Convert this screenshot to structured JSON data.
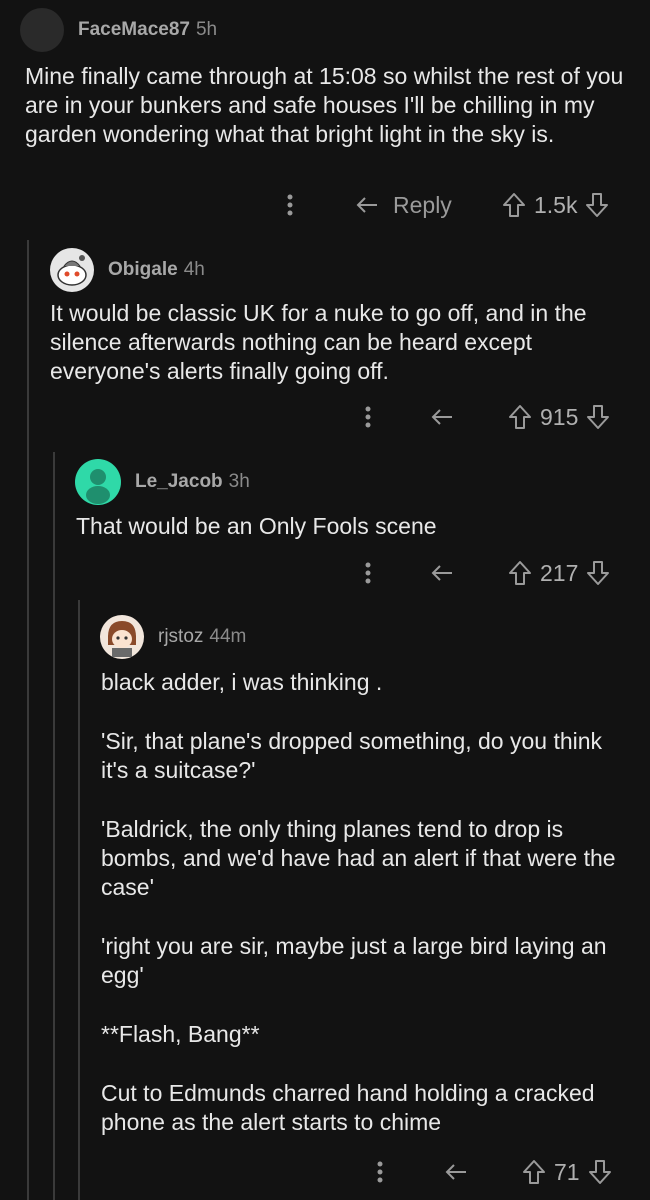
{
  "comments": [
    {
      "username": "FaceMace87",
      "age": "5h",
      "avatar_color": "#2a2a2a",
      "paragraphs": [
        "Mine finally came through at 15:08 so whilst the rest of you are in your bunkers and safe houses I'll be chilling in my garden wondering what that bright light in the sky is."
      ],
      "reply_label": "Reply",
      "score": "1.5k"
    },
    {
      "username": "Obigale",
      "age": "4h",
      "avatar_color": "#e6e6e6",
      "paragraphs": [
        "It would be classic UK for a nuke to go off, and in the silence afterwards nothing can be heard except everyone's alerts finally going off."
      ],
      "score": "915"
    },
    {
      "username": "Le_Jacob",
      "age": "3h",
      "avatar_color": "#2fd9a8",
      "paragraphs": [
        "That would be an Only Fools scene"
      ],
      "score": "217"
    },
    {
      "username": "rjstoz",
      "age": "44m",
      "avatar_color": "#f2e6dc",
      "paragraphs": [
        "black adder, i was thinking .",
        "'Sir, that plane's dropped something, do you think it's a suitcase?'",
        "'Baldrick, the only thing planes tend to drop is bombs, and we'd have had an alert if that were the case'",
        "'right you are sir, maybe just a large bird laying an egg'",
        "**Flash, Bang**",
        "Cut to Edmunds charred hand holding a cracked phone as the alert starts to chime"
      ],
      "score": "71"
    }
  ]
}
